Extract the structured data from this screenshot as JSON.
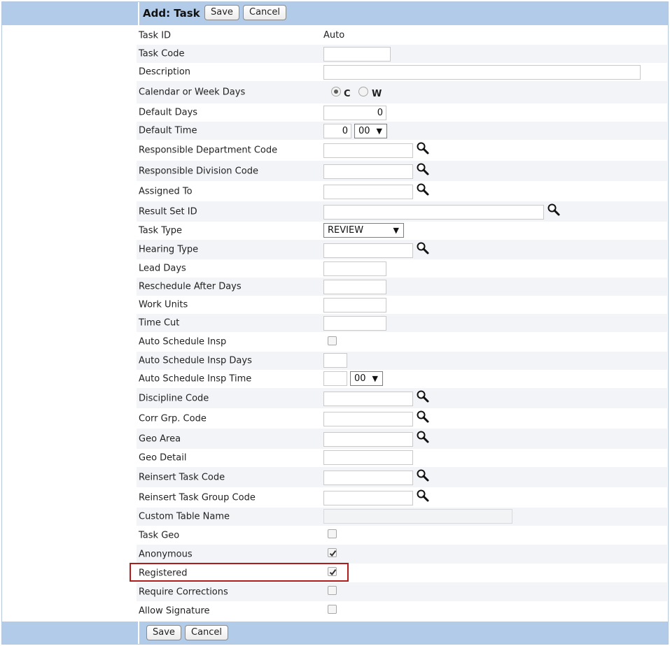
{
  "header": {
    "title": "Add: Task",
    "save_label": "Save",
    "cancel_label": "Cancel"
  },
  "footer": {
    "save_label": "Save",
    "cancel_label": "Cancel"
  },
  "fields": {
    "task_id": {
      "label": "Task ID",
      "value": "Auto"
    },
    "task_code": {
      "label": "Task Code",
      "value": ""
    },
    "description": {
      "label": "Description",
      "value": ""
    },
    "calendar_or_week_days": {
      "label": "Calendar or Week Days",
      "options": [
        "C",
        "W"
      ],
      "selected": "C"
    },
    "default_days": {
      "label": "Default Days",
      "value": "0"
    },
    "default_time": {
      "label": "Default Time",
      "value": "0",
      "minutes": "00"
    },
    "responsible_department_code": {
      "label": "Responsible Department Code",
      "value": ""
    },
    "responsible_division_code": {
      "label": "Responsible Division Code",
      "value": ""
    },
    "assigned_to": {
      "label": "Assigned To",
      "value": ""
    },
    "result_set_id": {
      "label": "Result Set ID",
      "value": ""
    },
    "task_type": {
      "label": "Task Type",
      "value": "REVIEW"
    },
    "hearing_type": {
      "label": "Hearing Type",
      "value": ""
    },
    "lead_days": {
      "label": "Lead Days",
      "value": ""
    },
    "reschedule_after_days": {
      "label": "Reschedule After Days",
      "value": ""
    },
    "work_units": {
      "label": "Work Units",
      "value": ""
    },
    "time_cut": {
      "label": "Time Cut",
      "value": ""
    },
    "auto_schedule_insp": {
      "label": "Auto Schedule Insp",
      "checked": false
    },
    "auto_schedule_insp_days": {
      "label": "Auto Schedule Insp Days",
      "value": ""
    },
    "auto_schedule_insp_time": {
      "label": "Auto Schedule Insp Time",
      "value": "",
      "minutes": "00"
    },
    "discipline_code": {
      "label": "Discipline Code",
      "value": ""
    },
    "corr_grp_code": {
      "label": "Corr Grp. Code",
      "value": ""
    },
    "geo_area": {
      "label": "Geo Area",
      "value": ""
    },
    "geo_detail": {
      "label": "Geo Detail",
      "value": ""
    },
    "reinsert_task_code": {
      "label": "Reinsert Task Code",
      "value": ""
    },
    "reinsert_task_group_code": {
      "label": "Reinsert Task Group Code",
      "value": ""
    },
    "custom_table_name": {
      "label": "Custom Table Name",
      "value": ""
    },
    "task_geo": {
      "label": "Task Geo",
      "checked": false
    },
    "anonymous": {
      "label": "Anonymous",
      "checked": true
    },
    "registered": {
      "label": "Registered",
      "checked": true
    },
    "require_corrections": {
      "label": "Require Corrections",
      "checked": false
    },
    "allow_signature": {
      "label": "Allow Signature",
      "checked": false
    }
  },
  "colors": {
    "band": "#b1cbe8",
    "row_alt": "#f2f4f7",
    "highlight_border": "#b31b1b"
  },
  "icons": {
    "lookup": "magnifier-icon",
    "check": "checkmark-icon",
    "dropdown": "triangle-down-icon"
  }
}
